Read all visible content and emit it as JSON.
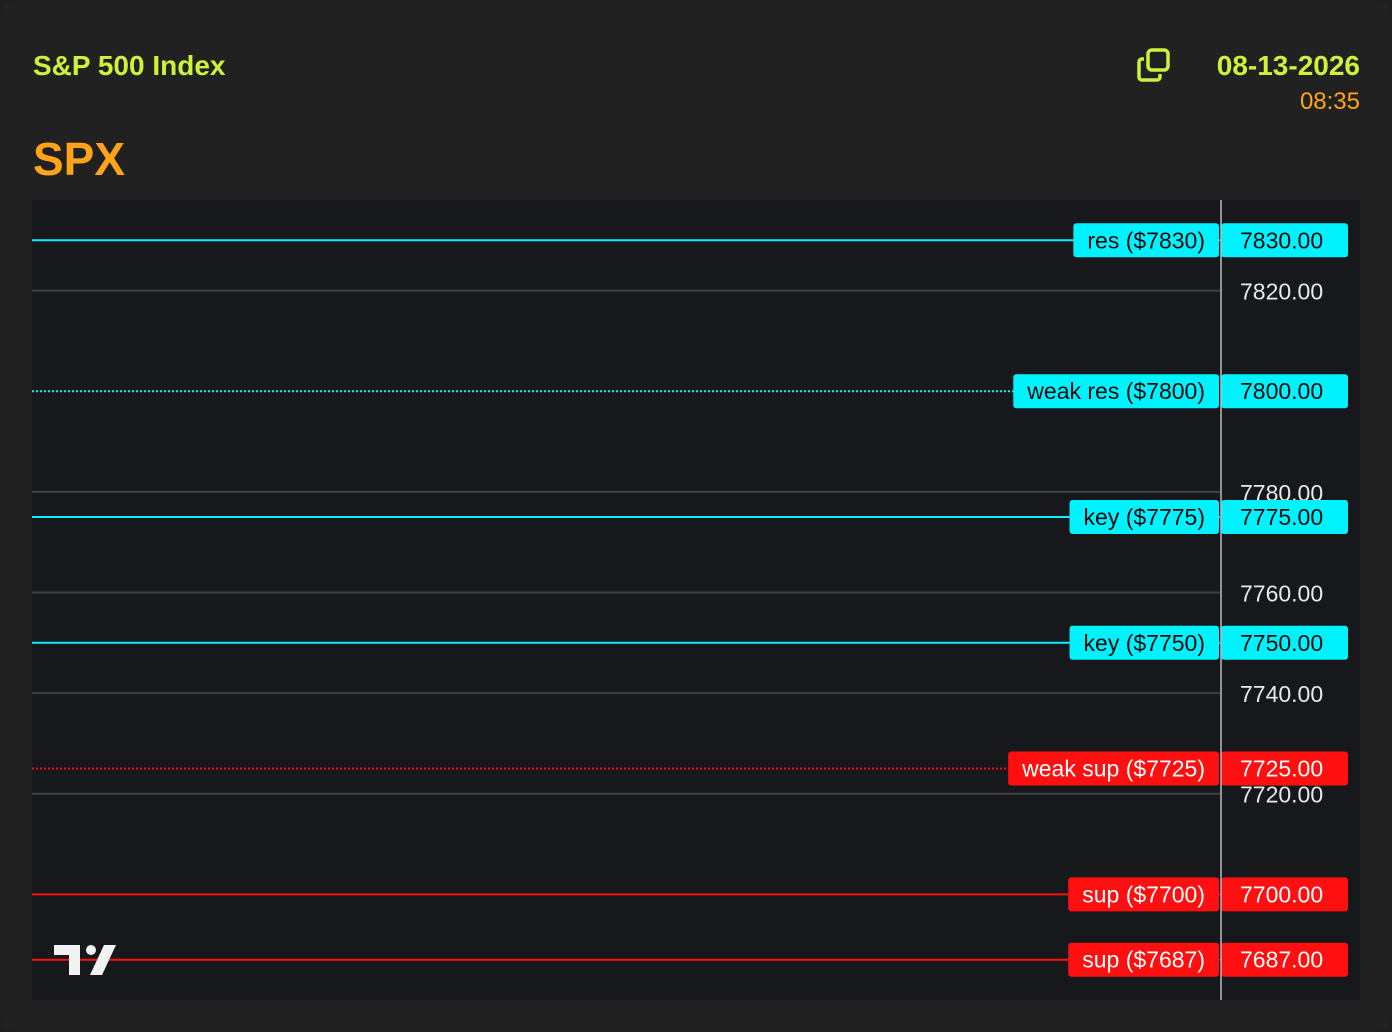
{
  "header": {
    "index_name": "S&P 500 Index",
    "date": "08-13-2026",
    "time": "08:35",
    "ticker": "SPX",
    "copy_icon": "copy-icon"
  },
  "colors": {
    "accent_green": "#cdf23a",
    "accent_orange": "#ffa31a",
    "resistance": "#00f2ff",
    "support": "#ff0f0f",
    "gridline": "#3f4046",
    "chart_bg": "#17181c"
  },
  "chart_data": {
    "type": "line",
    "title": "",
    "xlabel": "",
    "ylabel": "",
    "ylim": [
      7679,
      7838
    ],
    "grid": "horizontal",
    "y_ticks": [
      {
        "value": 7820,
        "label": "7820.00"
      },
      {
        "value": 7780,
        "label": "7780.00"
      },
      {
        "value": 7760,
        "label": "7760.00"
      },
      {
        "value": 7740,
        "label": "7740.00"
      },
      {
        "value": 7720,
        "label": "7720.00"
      }
    ],
    "levels": [
      {
        "value": 7830,
        "label": "res ($7830)",
        "price_label": "7830.00",
        "kind": "resistance",
        "style": "solid"
      },
      {
        "value": 7800,
        "label": "weak res ($7800)",
        "price_label": "7800.00",
        "kind": "resistance",
        "style": "dotted"
      },
      {
        "value": 7775,
        "label": "key ($7775)",
        "price_label": "7775.00",
        "kind": "resistance",
        "style": "solid"
      },
      {
        "value": 7750,
        "label": "key ($7750)",
        "price_label": "7750.00",
        "kind": "resistance",
        "style": "solid"
      },
      {
        "value": 7725,
        "label": "weak sup ($7725)",
        "price_label": "7725.00",
        "kind": "support",
        "style": "dotted"
      },
      {
        "value": 7700,
        "label": "sup ($7700)",
        "price_label": "7700.00",
        "kind": "support",
        "style": "solid"
      },
      {
        "value": 7687,
        "label": "sup ($7687)",
        "price_label": "7687.00",
        "kind": "support",
        "style": "solid"
      }
    ],
    "watermark_icon": "tradingview-logo-icon"
  }
}
